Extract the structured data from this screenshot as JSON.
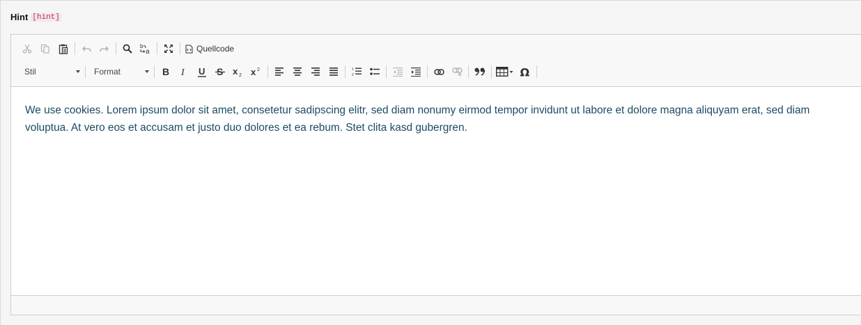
{
  "field": {
    "label": "Hint",
    "code": "[hint]"
  },
  "toolbar": {
    "row1": [
      {
        "name": "cut-button",
        "icon": "scissors-icon",
        "disabled": true
      },
      {
        "name": "copy-button",
        "icon": "copy-icon",
        "disabled": true
      },
      {
        "name": "paste-button",
        "icon": "clipboard-icon",
        "disabled": false
      },
      {
        "name": "undo-button",
        "icon": "undo-icon",
        "disabled": true
      },
      {
        "name": "redo-button",
        "icon": "redo-icon",
        "disabled": true
      },
      {
        "name": "find-button",
        "icon": "magnifier-icon",
        "disabled": false
      },
      {
        "name": "replace-button",
        "icon": "replace-icon",
        "disabled": false
      },
      {
        "name": "maximize-button",
        "icon": "expand-icon",
        "disabled": false
      },
      {
        "name": "source-button",
        "icon": "source-code-icon",
        "label": "Quellcode"
      }
    ],
    "style_combo_label": "Stil",
    "format_combo_label": "Format",
    "source_label": "Quellcode"
  },
  "content": {
    "text": "We use cookies. Lorem ipsum dolor sit amet, consetetur sadipscing elitr, sed diam nonumy eirmod tempor invidunt ut labore et dolore magna aliquyam erat, sed diam voluptua. At vero eos et accusam et justo duo dolores et ea rebum. Stet clita kasd gubergren."
  },
  "colors": {
    "text": "#1b4a63",
    "code": "#c7254e",
    "toolbar_bg": "#f8f8f8",
    "border": "#cfcfcf"
  }
}
